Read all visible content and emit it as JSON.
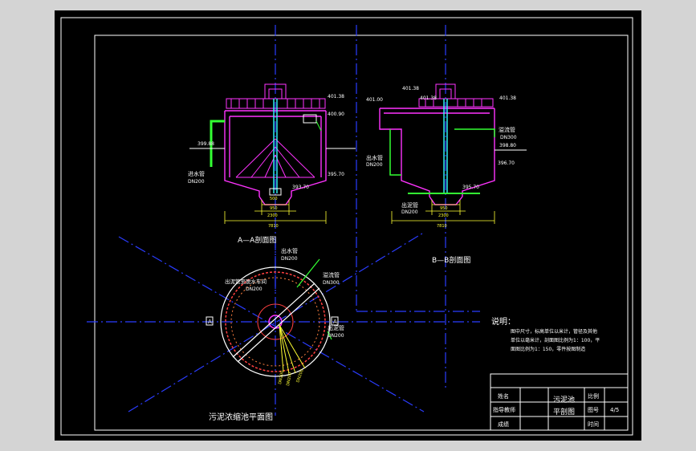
{
  "colors": {
    "background": "#000000",
    "frame": "#ffffff",
    "centerline": "#2a3cff",
    "wall": "#ff33ff",
    "pipe": "#33ff33",
    "dimension": "#ffff33",
    "cyan": "#33ffff",
    "red": "#ff4040"
  },
  "section_aa": {
    "title": "A—A剖面图",
    "inlet_pipe": "进水管",
    "inlet_dn": "DN200",
    "levels": {
      "top": "401.38",
      "water": "400.90",
      "ground": "399.88",
      "bottom": "395.70",
      "sump": "393.70"
    },
    "dims": {
      "overall": "7810",
      "sump_w": "2300",
      "sump_inner": "950",
      "cone": "500"
    }
  },
  "section_bb": {
    "title": "B—B剖面图",
    "overflow_pipe": "溢流管",
    "overflow_dn": "DN300",
    "outlet_pipe": "出水管",
    "outlet_dn": "DN200",
    "sludge_pipe": "出泥管",
    "sludge_dn": "DN200",
    "levels": {
      "top_left": "401.00",
      "top_mid": "401.38",
      "top_right": "401.38",
      "side": "398.80",
      "bottom": "396.70",
      "sump": "395.70"
    },
    "dims": {
      "overall": "7810",
      "sump_w": "2300",
      "sump_inner": "950"
    }
  },
  "plan": {
    "title": "污泥浓缩池平面图",
    "outlet_pipe": "出水管",
    "outlet_dn": "DN200",
    "overflow_pipe": "溢流管",
    "overflow_dn": "DN300",
    "sludge_pipe": "出泥管",
    "sludge_dn": "DN200",
    "bridge": "出泥管至脱水车间",
    "bridge_dn": "DN200",
    "marker_a": "A",
    "tick_labels": [
      "DN200",
      "DN200",
      "DN200"
    ]
  },
  "notes": {
    "title": "说明：",
    "lines": [
      "图中尺寸，标高单位以米计，管径及其他",
      "单位以毫米计，剖面图比例为1：100，平",
      "面图比例为1：150，零件按图制造"
    ]
  },
  "title_block": {
    "name_label": "姓名",
    "teacher_label": "指导教师",
    "score_label": "成绩",
    "drawing_title_1": "污泥池",
    "drawing_title_2": "平剖图",
    "scale_label": "比例",
    "drawing_no_label": "图号",
    "drawing_no": "4/5",
    "date_label": "时间"
  }
}
